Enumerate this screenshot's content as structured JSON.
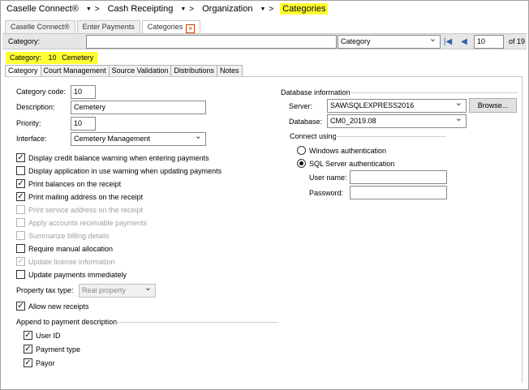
{
  "breadcrumb": {
    "items": [
      "Caselle Connect®",
      "Cash Receipting",
      "Organization",
      "Categories"
    ],
    "separator": ">"
  },
  "tabs": [
    "Caselle Connect®",
    "Enter Payments",
    "Categories"
  ],
  "category_bar": {
    "label": "Category:",
    "search_value": "",
    "field_select": "Category",
    "record_number": "10",
    "record_total": "of 19"
  },
  "current_category": {
    "label": "Category:",
    "code": "10",
    "name": "Cemetery"
  },
  "sub_tabs": [
    "Category",
    "Court Management",
    "Source Validation",
    "Distributions",
    "Notes"
  ],
  "form": {
    "category_code_label": "Category code:",
    "category_code": "10",
    "description_label": "Description:",
    "description": "Cemetery",
    "priority_label": "Priority:",
    "priority": "10",
    "interface_label": "Interface:",
    "interface": "Cemetery Management",
    "options": [
      {
        "label": "Display credit balance warning when entering payments",
        "checked": true,
        "disabled": false
      },
      {
        "label": "Display application in use warning when updating payments",
        "checked": false,
        "disabled": false
      },
      {
        "label": "Print balances on the receipt",
        "checked": true,
        "disabled": false
      },
      {
        "label": "Print mailing address on the receipt",
        "checked": true,
        "disabled": false
      },
      {
        "label": "Print service address on the receipt",
        "checked": false,
        "disabled": true
      },
      {
        "label": "Apply accounts receivable payments",
        "checked": false,
        "disabled": true
      },
      {
        "label": "Summarize billing details",
        "checked": false,
        "disabled": true
      },
      {
        "label": "Require manual allocation",
        "checked": false,
        "disabled": false
      },
      {
        "label": "Update license information",
        "checked": true,
        "disabled": true
      },
      {
        "label": "Update payments immediately",
        "checked": false,
        "disabled": false
      }
    ],
    "property_tax_type_label": "Property tax type:",
    "property_tax_type": "Real property",
    "allow_new_receipts": {
      "label": "Allow new receipts",
      "checked": true
    },
    "append_group_label": "Append to payment description",
    "append_options": [
      {
        "label": "User ID",
        "checked": true
      },
      {
        "label": "Payment type",
        "checked": true
      },
      {
        "label": "Payor",
        "checked": true
      }
    ]
  },
  "database": {
    "group_label": "Database information",
    "server_label": "Server:",
    "server": "SAW\\SQLEXPRESS2016",
    "browse_label": "Browse...",
    "database_label": "Database:",
    "database": "CM0_2019.08",
    "connect_label": "Connect using",
    "windows_auth": "Windows authentication",
    "sql_auth": "SQL Server authentication",
    "selected_auth": "sql",
    "username_label": "User name:",
    "username": "",
    "password_label": "Password:",
    "password": ""
  },
  "colors": {
    "highlight": "#ffff33",
    "nav_icon": "#2e5ea8",
    "close_icon": "#c04000"
  }
}
